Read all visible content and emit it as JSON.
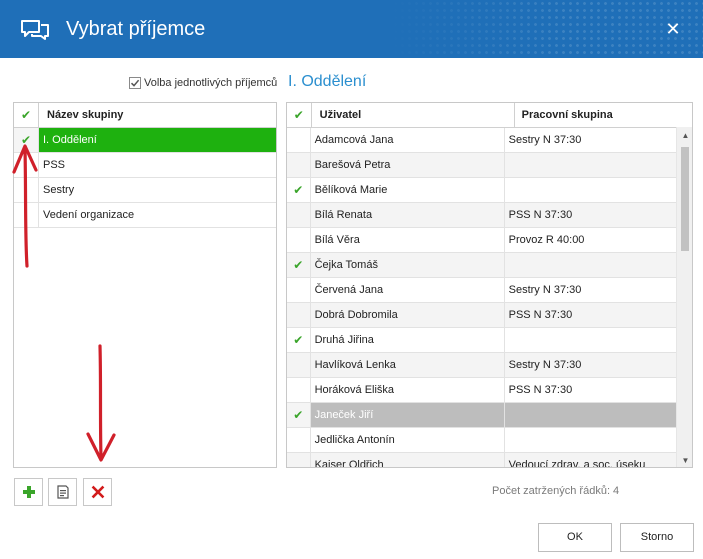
{
  "window": {
    "title": "Vybrat příjemce"
  },
  "options": {
    "individual_label": "Volba jednotlivých příjemců",
    "individual_checked": true
  },
  "department_title": "I. Oddělení",
  "groups": {
    "header": "Název skupiny",
    "rows": [
      {
        "name": "I. Oddělení",
        "checked": true,
        "selected": true
      },
      {
        "name": "PSS",
        "checked": false
      },
      {
        "name": "Sestry",
        "checked": false
      },
      {
        "name": "Vedení organizace",
        "checked": false
      }
    ]
  },
  "users": {
    "header_user": "Uživatel",
    "header_group": "Pracovní skupina",
    "rows": [
      {
        "user": "Adamcová Jana",
        "group": "Sestry N 37:30",
        "checked": false
      },
      {
        "user": "Barešová Petra",
        "group": "",
        "checked": false
      },
      {
        "user": "Bělíková Marie",
        "group": "",
        "checked": true
      },
      {
        "user": "Bílá Renata",
        "group": "PSS N 37:30",
        "checked": false
      },
      {
        "user": "Bílá Věra",
        "group": "Provoz R 40:00",
        "checked": false
      },
      {
        "user": "Čejka Tomáš",
        "group": "",
        "checked": true
      },
      {
        "user": "Červená Jana",
        "group": "Sestry N 37:30",
        "checked": false
      },
      {
        "user": "Dobrá Dobromila",
        "group": "PSS N 37:30",
        "checked": false
      },
      {
        "user": "Druhá Jiřina",
        "group": "",
        "checked": true
      },
      {
        "user": "Havlíková Lenka",
        "group": "Sestry N 37:30",
        "checked": false
      },
      {
        "user": "Horáková Eliška",
        "group": "PSS N 37:30",
        "checked": false
      },
      {
        "user": "Janeček Jiří",
        "group": "",
        "checked": true,
        "highlighted": true
      },
      {
        "user": "Jedlička Antonín",
        "group": "",
        "checked": false
      },
      {
        "user": "Kaiser Oldřich",
        "group": "Vedoucí zdrav. a soc. úseku",
        "checked": false
      }
    ]
  },
  "footer": {
    "checked_count_label": "Počet zatržených řádků:",
    "checked_count": "4",
    "ok_label": "OK",
    "cancel_label": "Storno"
  },
  "icons": {
    "check": "checkmark-icon",
    "add": "plus-icon",
    "edit": "document-edit-icon",
    "delete": "delete-x-icon",
    "title": "chat-bubbles-icon",
    "close": "close-icon"
  },
  "colors": {
    "titlebar": "#1f6fb8",
    "selection": "#1eb10f",
    "check": "#3aa52a",
    "highlight_row": "#bdbdbd",
    "accent_text": "#2b8fcf",
    "annotation_arrow": "#d0202a"
  }
}
